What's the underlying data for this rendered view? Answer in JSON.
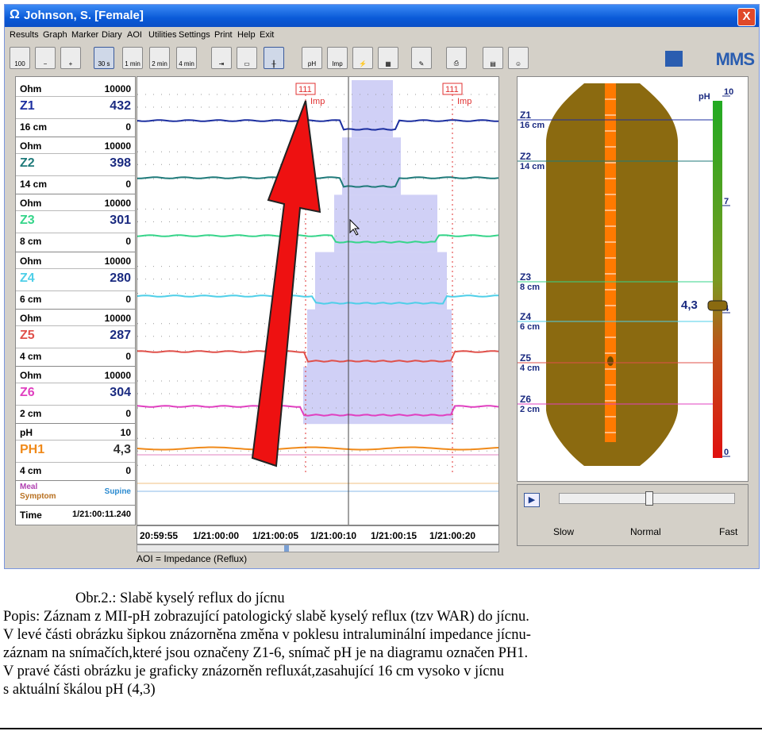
{
  "window": {
    "title": "Johnson, S. [Female]",
    "close": "X"
  },
  "menu": [
    "Results",
    "Graph",
    "Marker",
    "Diary",
    "AOI",
    "Utilities",
    "Settings",
    "Print",
    "Help",
    "Exit"
  ],
  "toolbar": {
    "zoom": [
      "30 s",
      "1 min",
      "2 min",
      "4 min"
    ],
    "brand": "MMS",
    "icon_names": [
      "zoom-100-icon",
      "zoom-out-icon",
      "zoom-in-icon",
      "timescale-30s-icon",
      "timescale-1min-icon",
      "timescale-2min-icon",
      "timescale-4min-icon",
      "marker-arrow-icon",
      "ruler-icon",
      "calipers-icon",
      "ph-report-icon",
      "impedance-report-icon",
      "ph-impedance-report-icon",
      "summary-report-icon",
      "print-preview-icon",
      "printer-icon",
      "book-icon",
      "patient-icon"
    ],
    "report_labels": [
      "pH",
      "Imp"
    ]
  },
  "channels": [
    {
      "unit": "Ohm",
      "max": "10000",
      "name": "Z1",
      "value": "432",
      "pos": "16 cm",
      "min": "0",
      "color": "#1c2fa0"
    },
    {
      "unit": "Ohm",
      "max": "10000",
      "name": "Z2",
      "value": "398",
      "pos": "14 cm",
      "min": "0",
      "color": "#1f7a7a"
    },
    {
      "unit": "Ohm",
      "max": "10000",
      "name": "Z3",
      "value": "301",
      "pos": "8 cm",
      "min": "0",
      "color": "#36d58a"
    },
    {
      "unit": "Ohm",
      "max": "10000",
      "name": "Z4",
      "value": "280",
      "pos": "6 cm",
      "min": "0",
      "color": "#4fcfe8"
    },
    {
      "unit": "Ohm",
      "max": "10000",
      "name": "Z5",
      "value": "287",
      "pos": "4 cm",
      "min": "0",
      "color": "#e0504a"
    },
    {
      "unit": "Ohm",
      "max": "10000",
      "name": "Z6",
      "value": "304",
      "pos": "2 cm",
      "min": "0",
      "color": "#e040c0"
    },
    {
      "unit": "pH",
      "max": "10",
      "name": "PH1",
      "value": "4,3",
      "pos": "4 cm",
      "min": "0",
      "color": "#f08a1a"
    }
  ],
  "meal": {
    "label1": "Meal",
    "label2": "Symptom",
    "state": "Supine"
  },
  "time": {
    "label": "Time",
    "value": "1/21:00:11.240",
    "ticks": [
      "20:59:55",
      "1/21:00:00",
      "1/21:00:05",
      "1/21:00:10",
      "1/21:00:15",
      "1/21:00:20"
    ]
  },
  "markers": {
    "top": "111",
    "label": "Imp"
  },
  "aoi": "AOI = Impedance (Reflux)",
  "diagram": {
    "sensors": [
      {
        "name": "Z1",
        "pos": "16 cm"
      },
      {
        "name": "Z2",
        "pos": "14 cm"
      },
      {
        "name": "Z3",
        "pos": "8 cm"
      },
      {
        "name": "Z4",
        "pos": "6 cm"
      },
      {
        "name": "Z5",
        "pos": "4 cm"
      },
      {
        "name": "Z6",
        "pos": "2 cm"
      }
    ],
    "ph_label": "pH",
    "scale": [
      "10",
      "7",
      "4",
      "0"
    ],
    "current": "4,3"
  },
  "playback": {
    "slow": "Slow",
    "normal": "Normal",
    "fast": "Fast",
    "play": "▶"
  },
  "caption": {
    "title": "Obr.2.: Slabě kyselý reflux do jícnu",
    "lines": [
      "Popis: Záznam z MII-pH zobrazující patologický slabě kyselý reflux (tzv WAR) do jícnu.",
      "V levé části obrázku šipkou znázorněna změna v poklesu intraluminální impedance jícnu-",
      "záznam na snímačích,které jsou označeny Z1-6, snímač pH je na diagramu označen PH1.",
      "V pravé části obrázku je graficky znázorněn refluxát,zasahující 16 cm vysoko v jícnu",
      "s aktuální škálou pH (4,3)"
    ]
  },
  "colors": {
    "esophagus": "#8b6a10",
    "probe": "#ff7a00",
    "ph_scale_top": "#22aa22",
    "ph_scale_bottom": "#e01010",
    "arrow": "#ee1111",
    "aoi_fill": "#c8c8f4"
  }
}
